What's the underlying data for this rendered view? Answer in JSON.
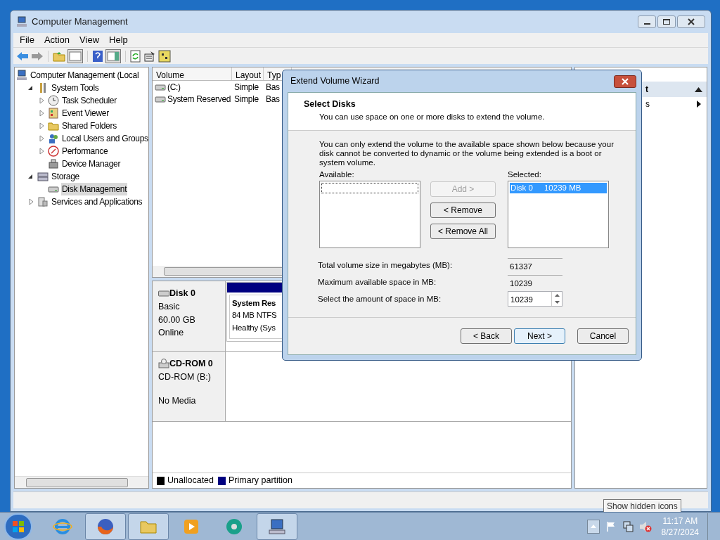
{
  "window": {
    "title": "Computer Management"
  },
  "menu": [
    "File",
    "Action",
    "View",
    "Help"
  ],
  "tree": [
    {
      "label": "Computer Management (Local",
      "kind": "computer",
      "selected": false,
      "children": [
        {
          "label": "System Tools",
          "kind": "tools",
          "expanded": true,
          "selected": false,
          "children": [
            {
              "label": "Task Scheduler",
              "kind": "clock",
              "expanded": false,
              "selected": false
            },
            {
              "label": "Event Viewer",
              "kind": "log",
              "expanded": false,
              "selected": false
            },
            {
              "label": "Shared Folders",
              "kind": "folder",
              "expanded": false,
              "selected": false
            },
            {
              "label": "Local Users and Groups",
              "kind": "users",
              "expanded": false,
              "selected": false
            },
            {
              "label": "Performance",
              "kind": "gauge",
              "expanded": false,
              "selected": false
            },
            {
              "label": "Device Manager",
              "kind": "device",
              "selected": false
            }
          ]
        },
        {
          "label": "Storage",
          "kind": "storage",
          "expanded": true,
          "selected": false,
          "children": [
            {
              "label": "Disk Management",
              "kind": "disk",
              "selected": true
            }
          ]
        },
        {
          "label": "Services and Applications",
          "kind": "services",
          "expanded": false,
          "selected": false
        }
      ]
    }
  ],
  "volumes": {
    "columns": [
      "Volume",
      "Layout",
      "Typ"
    ],
    "rows": [
      [
        "(C:)",
        "Simple",
        "Bas"
      ],
      [
        "System Reserved",
        "Simple",
        "Bas"
      ]
    ]
  },
  "disks": [
    {
      "kind": "disk",
      "name": "Disk 0",
      "lines": [
        "Basic",
        "60.00 GB",
        "Online"
      ],
      "partitions": [
        {
          "title": "System Res",
          "lines": [
            "84 MB NTFS",
            "Healthy (Sys"
          ]
        }
      ]
    },
    {
      "kind": "cdrom",
      "name": "CD-ROM 0",
      "lines": [
        "CD-ROM (B:)",
        "No Media"
      ]
    }
  ],
  "legend": [
    {
      "label": "Unallocated",
      "color": "#000000"
    },
    {
      "label": "Primary partition",
      "color": "#000080"
    }
  ],
  "actions": {
    "header": "t",
    "items": [
      "s"
    ]
  },
  "dialog": {
    "title": "Extend Volume Wizard",
    "heading": "Select Disks",
    "subtitle": "You can use space on one or more disks to extend the volume.",
    "note": "You can only extend the volume to the available space shown below because your disk cannot be converted to dynamic or the volume being extended is a boot or system volume.",
    "available_label": "Available:",
    "selected_label": "Selected:",
    "selected_items": [
      {
        "disk": "Disk 0",
        "size": "10239 MB",
        "selected": true
      }
    ],
    "move_buttons": [
      {
        "label": "Add >",
        "disabled": true
      },
      {
        "label": "< Remove",
        "disabled": false
      },
      {
        "label": "< Remove All",
        "disabled": false
      }
    ],
    "fields": [
      {
        "kind": "readonly",
        "label": "Total volume size in megabytes (MB):",
        "value": "61337"
      },
      {
        "kind": "readonly",
        "label": "Maximum available space in MB:",
        "value": "10239"
      },
      {
        "kind": "spinner",
        "label": "Select the amount of space in MB:",
        "value": "10239"
      }
    ],
    "buttons": [
      {
        "label": "< Back",
        "default": false
      },
      {
        "label": "Next >",
        "default": true
      },
      {
        "label": "Cancel",
        "default": false
      }
    ]
  },
  "taskbar": {
    "apps": [
      {
        "kind": "ie",
        "open": false
      },
      {
        "kind": "firefox",
        "open": true
      },
      {
        "kind": "folder",
        "open": true
      },
      {
        "kind": "media",
        "open": false
      },
      {
        "kind": "disc",
        "open": false
      },
      {
        "kind": "computer",
        "open": true
      }
    ],
    "time": "11:17 AM",
    "date": "8/27/2024",
    "tooltip": "Show hidden icons"
  }
}
